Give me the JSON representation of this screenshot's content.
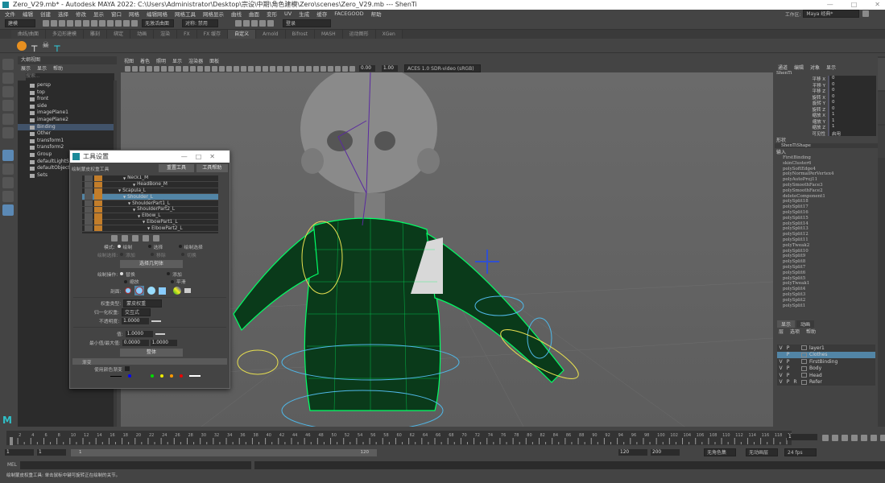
{
  "window": {
    "title": "Zero_V29.mb* - Autodesk MAYA 2022: C:\\Users\\Administrator\\Desktop\\宗设\\中期\\角色建模\\Zero\\scenes\\Zero_V29.mb  ---  ShenTi",
    "minimize": "—",
    "maximize": "□",
    "close": "✕"
  },
  "menubar": [
    "文件",
    "编辑",
    "创建",
    "选择",
    "修改",
    "显示",
    "窗口",
    "网格",
    "编辑网格",
    "网格工具",
    "网格显示",
    "曲线",
    "曲面",
    "变形",
    "UV",
    "生成",
    "缓存",
    "FACEGOOD",
    "帮助"
  ],
  "workspace": {
    "label": "工作区:",
    "value": "Maya 经典*"
  },
  "toolbar": {
    "mode": "建模",
    "live_surface": "无激活曲面",
    "symmetry": "对称: 禁用",
    "login": "登录"
  },
  "shelf_tabs": [
    "曲线/曲面",
    "多边形建模",
    "雕刻",
    "绑定",
    "动画",
    "渲染",
    "FX",
    "FX 缓存",
    "自定义",
    "Arnold",
    "Bifrost",
    "MASH",
    "运动图形",
    "XGen"
  ],
  "shelf_active": "自定义",
  "outliner": {
    "title": "大纲视图",
    "menu": [
      "展示",
      "显示",
      "帮助"
    ],
    "search_placeholder": "搜索...",
    "items": [
      {
        "label": "persp",
        "icon": "camera"
      },
      {
        "label": "top",
        "icon": "camera"
      },
      {
        "label": "front",
        "icon": "camera"
      },
      {
        "label": "side",
        "icon": "camera"
      },
      {
        "label": "imagePlane1",
        "icon": "image-plane"
      },
      {
        "label": "imagePlane2",
        "icon": "image-plane"
      },
      {
        "label": "Binding",
        "icon": "group",
        "selected": true
      },
      {
        "label": "Other",
        "icon": "group"
      },
      {
        "label": "transform1",
        "icon": "transform"
      },
      {
        "label": "transform2",
        "icon": "transform"
      },
      {
        "label": "Group",
        "icon": "group"
      },
      {
        "label": "defaultLightSet",
        "icon": "set"
      },
      {
        "label": "defaultObjectSet",
        "icon": "set"
      },
      {
        "label": "Sets",
        "icon": "set"
      }
    ]
  },
  "viewport": {
    "menu": [
      "视图",
      "着色",
      "照明",
      "显示",
      "渲染器",
      "面板"
    ],
    "exposure": "0.00",
    "gamma": "1.00",
    "colorspace": "ACES 1.0 SDR-video (sRGB)"
  },
  "tool_settings": {
    "title": "工具设置",
    "tool_name": "绘制蒙皮权重工具",
    "reset": "重置工具",
    "help": "工具帮助",
    "joints": [
      {
        "label": "Neck1_M",
        "indent": 4
      },
      {
        "label": "HeadBone_M",
        "indent": 6
      },
      {
        "label": "Scapula_L",
        "indent": 3
      },
      {
        "label": "Shoulder_L",
        "indent": 4,
        "selected": true
      },
      {
        "label": "ShoulderPart1_L",
        "indent": 5
      },
      {
        "label": "ShoulderPart2_L",
        "indent": 6
      },
      {
        "label": "Elbow_L",
        "indent": 7
      },
      {
        "label": "ElbowPart1_L",
        "indent": 8
      },
      {
        "label": "ElbowPart2_L",
        "indent": 9
      }
    ],
    "mode_label": "模式:",
    "mode_options": [
      "绘制",
      "选择",
      "绘制选择"
    ],
    "paint_select_label": "绘制选择:",
    "paint_select_options": [
      "添加",
      "移除",
      "切换"
    ],
    "select_geometry": "选择几何体",
    "paint_op_label": "绘制操作:",
    "paint_ops": [
      "替换",
      "添加",
      "缩放",
      "平滑"
    ],
    "profile_label": "剖面:",
    "weight_type_label": "权重类型:",
    "weight_type": "蒙皮权重",
    "normalize_label": "归一化权重:",
    "normalize": "交互式",
    "opacity_label": "不透明度:",
    "opacity": "1.0000",
    "value_label": "值:",
    "value": "1.0000",
    "minmax_label": "最小值/最大值:",
    "min": "0.0000",
    "max": "1.0000",
    "flood": "整体",
    "gradient_section": "渐变",
    "use_color_ramp": "使用颜色渐变"
  },
  "channel_box": {
    "menu": [
      "通道",
      "编辑",
      "对象",
      "显示"
    ],
    "object": "ShenTi",
    "attrs": [
      {
        "name": "平移 X",
        "value": "0"
      },
      {
        "name": "平移 Y",
        "value": "0"
      },
      {
        "name": "平移 Z",
        "value": "0"
      },
      {
        "name": "旋转 X",
        "value": "0"
      },
      {
        "name": "旋转 Y",
        "value": "0"
      },
      {
        "name": "旋转 Z",
        "value": "0"
      },
      {
        "name": "缩放 X",
        "value": "1"
      },
      {
        "name": "缩放 Y",
        "value": "1"
      },
      {
        "name": "缩放 Z",
        "value": "1"
      },
      {
        "name": "可见性",
        "value": "启用"
      }
    ],
    "shapes_label": "形状",
    "shape": "ShenTiShape",
    "inputs_label": "输入",
    "inputs": [
      "FirstBinding",
      "skinCluster6",
      "polySoftEdge4",
      "polyNormalPerVertex4",
      "polyAutoProj11",
      "polySmoothFace3",
      "polySmoothFace2",
      "deleteComponent1",
      "polySplit18",
      "polySplit17",
      "polySplit16",
      "polySplit15",
      "polySplit14",
      "polySplit13",
      "polySplit12",
      "polySplit11",
      "polyTweak2",
      "polySplit10",
      "polySplit9",
      "polySplit8",
      "polySplit7",
      "polySplit6",
      "polySplit5",
      "polyTweak1",
      "polySplit4",
      "polySplit3",
      "polySplit2",
      "polySplit1"
    ]
  },
  "layers": {
    "tabs": [
      "显示",
      "动画"
    ],
    "menu": [
      "层",
      "选项",
      "帮助"
    ],
    "items": [
      {
        "v": "V",
        "p": "P",
        "r": "",
        "name": "layer1"
      },
      {
        "v": "",
        "p": "P",
        "r": "",
        "name": "Clothes",
        "selected": true
      },
      {
        "v": "V",
        "p": "P",
        "r": "",
        "name": "FirstBinding"
      },
      {
        "v": "V",
        "p": "P",
        "r": "",
        "name": "Body"
      },
      {
        "v": "V",
        "p": "P",
        "r": "",
        "name": "Head"
      },
      {
        "v": "V",
        "p": "P",
        "r": "R",
        "name": "Refer"
      }
    ]
  },
  "timeline": {
    "start": 1,
    "end": 120,
    "current": "1",
    "current_marker": "1"
  },
  "range": {
    "start": "1",
    "anim_start": "1",
    "slider_start": "1",
    "slider_end": "120",
    "end": "120",
    "anim_end": "200",
    "character_set": "无角色集",
    "anim_layer": "无动画层",
    "fps": "24 fps"
  },
  "mel": {
    "label": "MEL"
  },
  "help_line": "绘制蒙皮权重工具: 单击鼠标中键可旋转正在绘制的关节。",
  "colors": {
    "accent": "#5285a6",
    "wireframe": "#00ff66",
    "joint_curve": "#4fb8e8",
    "ctrl_yellow": "#e8e050"
  }
}
